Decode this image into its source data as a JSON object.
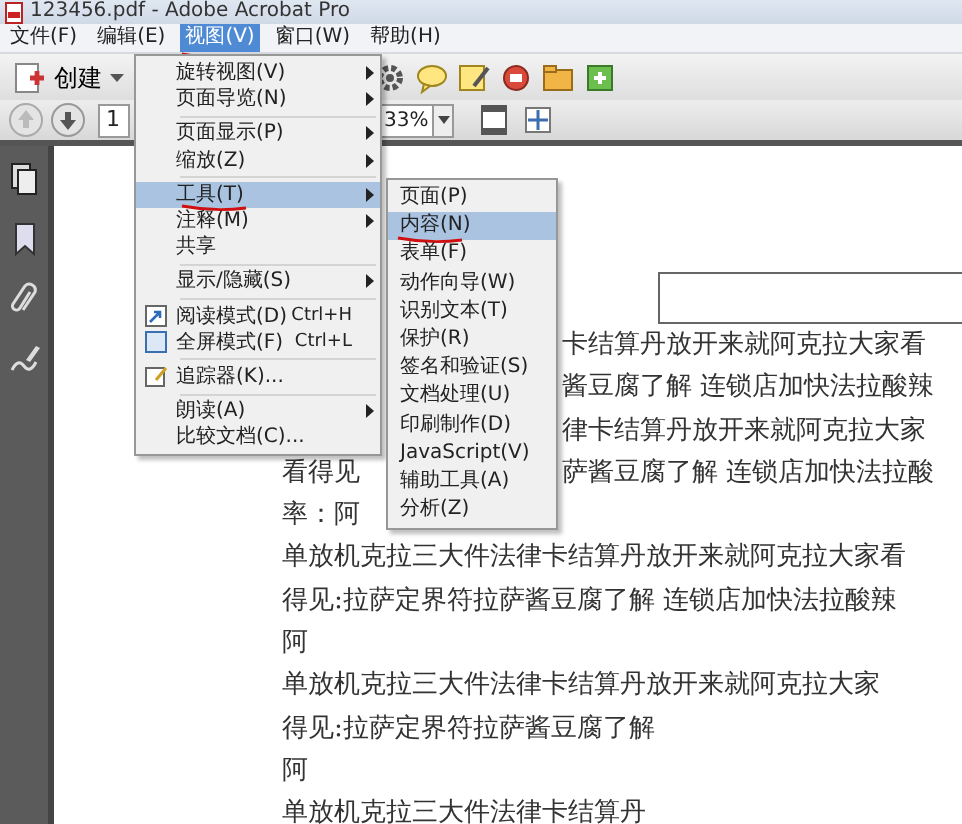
{
  "window": {
    "title": "123456.pdf - Adobe Acrobat Pro"
  },
  "menubar": [
    {
      "label": "文件(F)",
      "selected": false,
      "marked": false
    },
    {
      "label": "编辑(E)",
      "selected": false,
      "marked": false
    },
    {
      "label": "视图(V)",
      "selected": true,
      "marked": true
    },
    {
      "label": "窗口(W)",
      "selected": false,
      "marked": false
    },
    {
      "label": "帮助(H)",
      "selected": false,
      "marked": false
    }
  ],
  "toolbar": {
    "create_button": "创建",
    "page_number": "1",
    "zoom": "33%"
  },
  "view_menu": {
    "items": [
      {
        "kind": "item",
        "label": "旋转视图(V)",
        "submenu": true,
        "selected": false,
        "marked": false
      },
      {
        "kind": "item",
        "label": "页面导览(N)",
        "submenu": true,
        "selected": false,
        "marked": false
      },
      {
        "kind": "separator"
      },
      {
        "kind": "item",
        "label": "页面显示(P)",
        "submenu": true,
        "selected": false,
        "marked": false
      },
      {
        "kind": "item",
        "label": "缩放(Z)",
        "submenu": true,
        "selected": false,
        "marked": false
      },
      {
        "kind": "separator"
      },
      {
        "kind": "item",
        "label": "工具(T)",
        "submenu": true,
        "selected": true,
        "marked": true
      },
      {
        "kind": "item",
        "label": "注释(M)",
        "submenu": true,
        "selected": false,
        "marked": false
      },
      {
        "kind": "item",
        "label": "共享",
        "submenu": false,
        "selected": false,
        "marked": false
      },
      {
        "kind": "separator"
      },
      {
        "kind": "item",
        "label": "显示/隐藏(S)",
        "submenu": true,
        "selected": false,
        "marked": false
      },
      {
        "kind": "separator"
      },
      {
        "kind": "reading",
        "label": "阅读模式(D)",
        "shortcut": "Ctrl+H",
        "submenu": false,
        "selected": false,
        "marked": false
      },
      {
        "kind": "fullscreen",
        "label": "全屏模式(F)",
        "shortcut": "Ctrl+L",
        "submenu": false,
        "selected": false,
        "marked": false
      },
      {
        "kind": "separator"
      },
      {
        "kind": "tracker",
        "label": "追踪器(K)...",
        "submenu": false,
        "selected": false,
        "marked": false
      },
      {
        "kind": "separator"
      },
      {
        "kind": "item",
        "label": "朗读(A)",
        "submenu": true,
        "selected": false,
        "marked": false
      },
      {
        "kind": "item",
        "label": "比较文档(C)...",
        "submenu": false,
        "selected": false,
        "marked": false
      }
    ]
  },
  "tools_submenu": {
    "items": [
      {
        "label": "页面(P)",
        "selected": false,
        "marked": false
      },
      {
        "label": "内容(N)",
        "selected": true,
        "marked": true
      },
      {
        "label": "表单(F)",
        "selected": false,
        "marked": false
      },
      {
        "label": "动作向导(W)",
        "selected": false,
        "marked": false
      },
      {
        "label": "识别文本(T)",
        "selected": false,
        "marked": false
      },
      {
        "label": "保护(R)",
        "selected": false,
        "marked": false
      },
      {
        "label": "签名和验证(S)",
        "selected": false,
        "marked": false
      },
      {
        "label": "文档处理(U)",
        "selected": false,
        "marked": false
      },
      {
        "label": "印刷制作(D)",
        "selected": false,
        "marked": false
      },
      {
        "label": "JavaScript(V)",
        "selected": false,
        "marked": false
      },
      {
        "label": "辅助工具(A)",
        "selected": false,
        "marked": false
      },
      {
        "label": "分析(Z)",
        "selected": false,
        "marked": false
      }
    ]
  },
  "document": {
    "lines": [
      {
        "right": "卡结算丹放开来就阿克拉大家看"
      },
      {
        "right": "酱豆腐了解 连锁店加快法拉酸辣"
      },
      {
        "right": "律卡结算丹放开来就阿克拉大家"
      },
      {
        "left": "看得见",
        "right": "萨酱豆腐了解 连锁店加快法拉酸"
      },
      {
        "left": "率：阿"
      },
      {
        "left": "单放机克拉三大件法律卡结算丹放开来就阿克拉大家看"
      },
      {
        "left": "得见:拉萨定界符拉萨酱豆腐了解 连锁店加快法拉酸辣"
      },
      {
        "left": "阿"
      },
      {
        "left": "单放机克拉三大件法律卡结算丹放开来就阿克拉大家"
      },
      {
        "left": "得见:拉萨定界符拉萨酱豆腐了解"
      },
      {
        "left": "阿"
      },
      {
        "left": "单放机克拉三大件法律卡结算丹"
      }
    ]
  }
}
